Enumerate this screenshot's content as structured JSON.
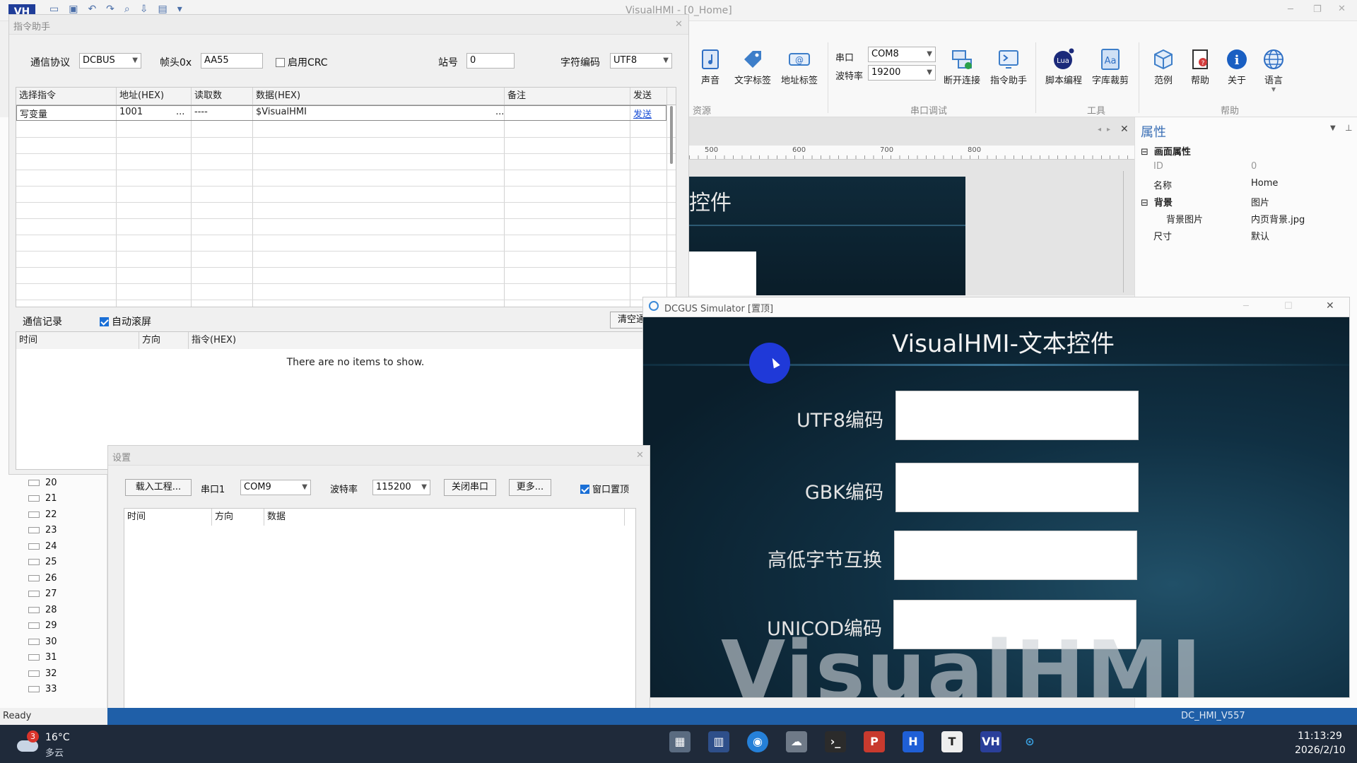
{
  "app": {
    "title": "VisualHMI - [0_Home]",
    "status": "Ready",
    "version": "DC_HMI_V557"
  },
  "ribbon": {
    "group_resources": {
      "label": "资源",
      "items": [
        "声音",
        "文字标签",
        "地址标签"
      ]
    },
    "group_serial": {
      "label": "串口调试",
      "port_label": "串口",
      "port_value": "COM8",
      "baud_label": "波特率",
      "baud_value": "19200",
      "items": [
        "断开连接",
        "指令助手"
      ]
    },
    "group_tools": {
      "label": "工具",
      "items": [
        "脚本编程",
        "字库裁剪"
      ]
    },
    "group_help": {
      "label": "帮助",
      "items": [
        "范例",
        "帮助",
        "关于",
        "语言"
      ]
    }
  },
  "ruler": {
    "ticks": [
      "500",
      "600",
      "700",
      "800"
    ]
  },
  "canvas_preview": {
    "title_fragment": "控件"
  },
  "properties": {
    "title": "属性",
    "sections": [
      {
        "name": "画面属性",
        "rows": [
          {
            "k": "ID",
            "v": "0"
          },
          {
            "k": "名称",
            "v": "Home"
          }
        ]
      },
      {
        "name": "背景",
        "value": "图片",
        "rows": [
          {
            "k": "背景图片",
            "v": "内页背景.jpg"
          },
          {
            "k": "尺寸",
            "v": "默认"
          }
        ]
      }
    ]
  },
  "cmd_helper": {
    "title": "指令助手",
    "protocol_label": "通信协议",
    "protocol_value": "DCBUS",
    "frame_label": "帧头0x",
    "frame_value": "AA55",
    "crc_label": "启用CRC",
    "station_label": "站号",
    "station_value": "0",
    "encoding_label": "字符编码",
    "encoding_value": "UTF8",
    "columns": [
      "选择指令",
      "地址(HEX)",
      "读取数",
      "数据(HEX)",
      "备注",
      "发送"
    ],
    "row": {
      "cmd": "写变量",
      "addr": "1001",
      "count": "----",
      "data": "$VisualHMI",
      "note": "",
      "send": "发送",
      "ellipsis": "..."
    },
    "log_label": "通信记录",
    "autoscroll_label": "自动滚屏",
    "clear_label": "清空通",
    "log_columns": [
      "时间",
      "方向",
      "指令(HEX)"
    ],
    "empty_text": "There are no items to show."
  },
  "settings": {
    "title": "设置",
    "load_label": "载入工程...",
    "port_label": "串口1",
    "port_value": "COM9",
    "baud_label": "波特率",
    "baud_value": "115200",
    "close_port_label": "关闭串口",
    "more_label": "更多...",
    "topmost_label": "窗口置顶",
    "columns": [
      "时间",
      "方向",
      "数据"
    ]
  },
  "tree": {
    "items": [
      "20",
      "21",
      "22",
      "23",
      "24",
      "25",
      "26",
      "27",
      "28",
      "29",
      "30",
      "31",
      "32",
      "33"
    ]
  },
  "simulator": {
    "title": "DCGUS Simulator [置顶]",
    "heading": "VisualHMI-文本控件",
    "labels": [
      "UTF8编码",
      "GBK编码",
      "高低字节互换",
      "UNICOD编码"
    ],
    "watermark": "VisualHMI"
  },
  "taskbar": {
    "temp": "16°C",
    "weather": "多云",
    "badge": "3",
    "time": "11:13:29",
    "date": "2026/2/10"
  },
  "colors": {
    "accent": "#1a6fd6",
    "simulator_bg": "#0d2433",
    "taskbar": "#1f2a3a"
  }
}
